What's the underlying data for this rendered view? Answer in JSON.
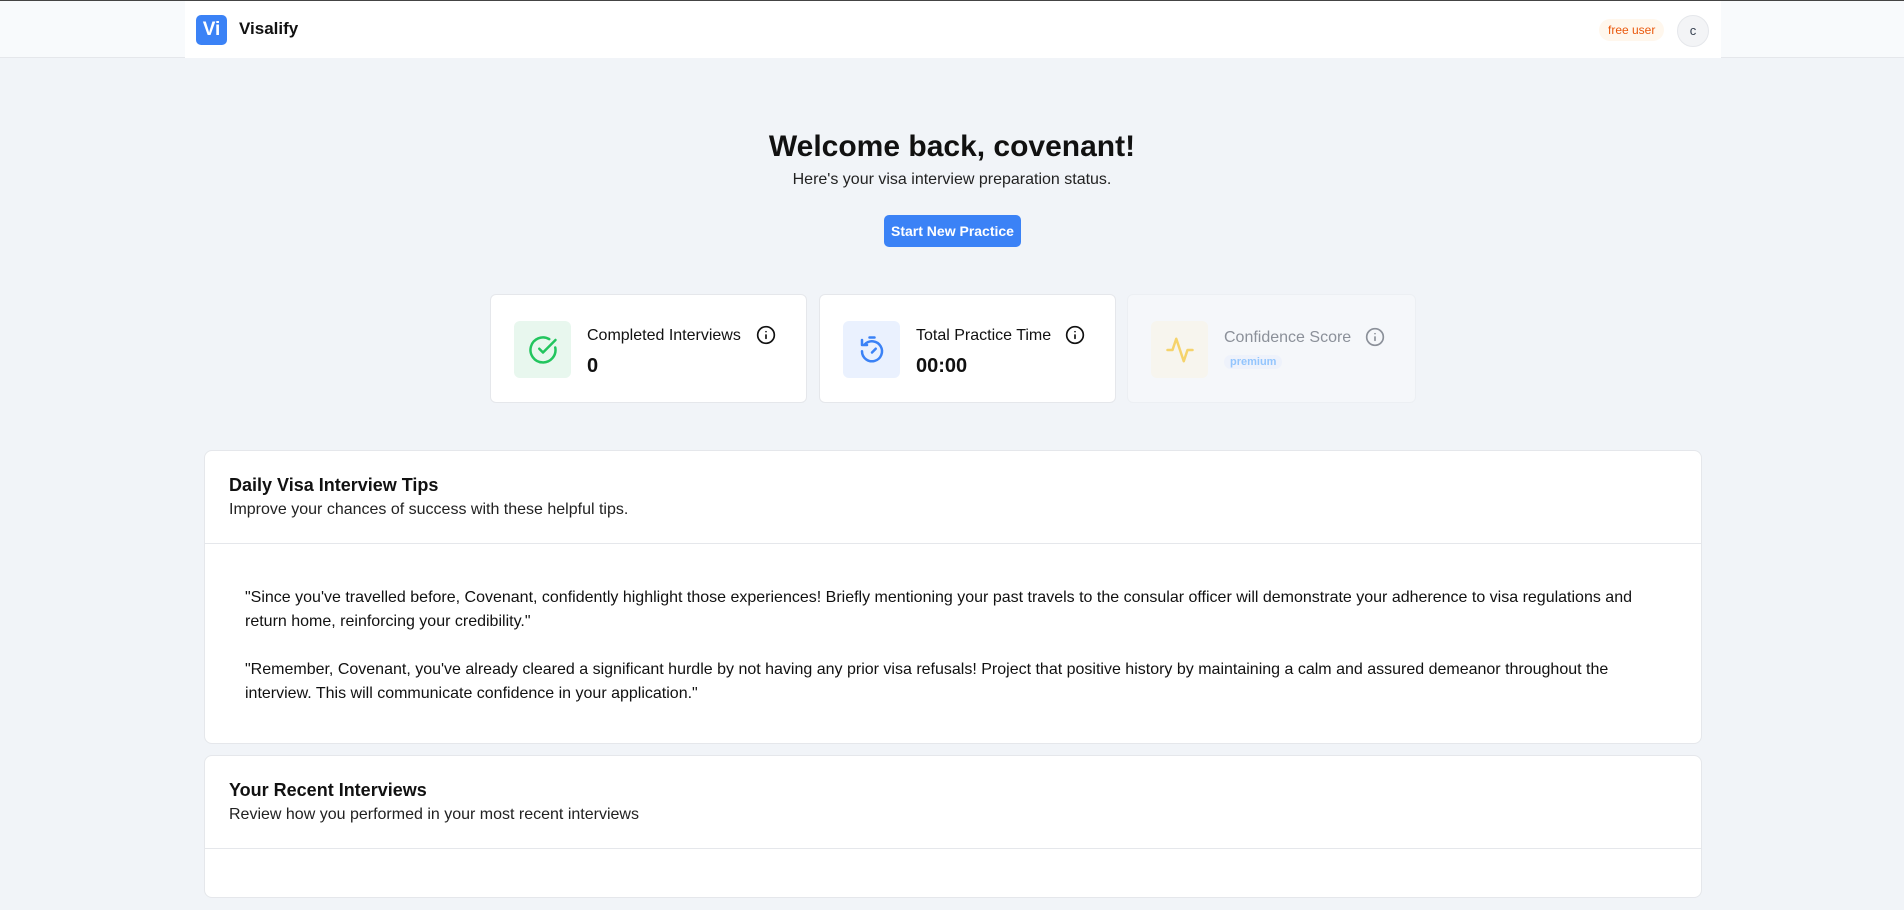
{
  "app": {
    "logo_text": "Vi",
    "brand": "Visalify",
    "plan_badge": "free user",
    "avatar_initial": "c"
  },
  "hero": {
    "welcome": "Welcome back, covenant!",
    "subtitle": "Here's your visa interview preparation status.",
    "cta_label": "Start New Practice"
  },
  "stats": [
    {
      "label": "Completed Interviews",
      "value": "0",
      "icon": "check-circle-icon",
      "accent": "#22c55e",
      "tint": "#e8f7ee"
    },
    {
      "label": "Total Practice Time",
      "value": "00:00",
      "icon": "timer-icon",
      "accent": "#3b82f6",
      "tint": "#eaf1fe"
    },
    {
      "label": "Confidence Score",
      "badge": "premium",
      "icon": "activity-icon",
      "accent": "#facc15",
      "tint": "#f7f5ee",
      "locked": true
    }
  ],
  "tips": {
    "title": "Daily Visa Interview Tips",
    "description": "Improve your chances of success with these helpful tips.",
    "items": [
      "\"Since you've travelled before, Covenant, confidently highlight those experiences! Briefly mentioning your past travels to the consular officer will demonstrate your adherence to visa regulations and return home, reinforcing your credibility.\"",
      "\"Remember, Covenant, you've already cleared a significant hurdle by not having any prior visa refusals! Project that positive history by maintaining a calm and assured demeanor throughout the interview. This will communicate confidence in your application.\""
    ]
  },
  "recent": {
    "title": "Your Recent Interviews",
    "description": "Review how you performed in your most recent interviews"
  },
  "colors": {
    "primary": "#3b82f6",
    "background": "#f1f4f8",
    "badge_text": "#ea580c",
    "badge_bg": "#fff7ed"
  }
}
